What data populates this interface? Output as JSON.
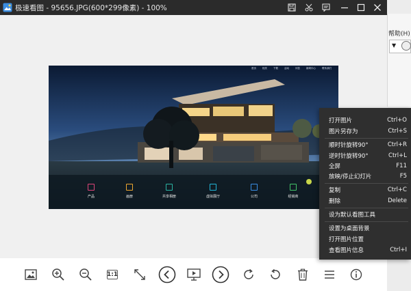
{
  "window": {
    "title": "极速看图 - 95656.JPG(600*299像素) - 100%",
    "icons": [
      "save-icon",
      "cut-icon",
      "comment-icon",
      "minimize-icon",
      "maximize-icon",
      "close-icon"
    ]
  },
  "background_app": {
    "help_label": "帮助(H)"
  },
  "photo": {
    "nav": [
      "首页",
      "相关",
      "下载",
      "活动",
      "问答",
      "新闻中心",
      "联系我们"
    ],
    "categories": [
      {
        "label": "产品",
        "color": "#e0457b"
      },
      {
        "label": "画册",
        "color": "#f0a830"
      },
      {
        "label": "共享相册",
        "color": "#2bb5a5"
      },
      {
        "label": "虚拟展厅",
        "color": "#22b6d8"
      },
      {
        "label": "公司",
        "color": "#3a8ee6"
      },
      {
        "label": "经销商",
        "color": "#43c46a"
      }
    ]
  },
  "toolbar": {
    "actual_size_label": "1:1",
    "tools": [
      "image-icon",
      "zoom-in-icon",
      "zoom-out-icon",
      "actual-size-icon",
      "fullscreen-icon",
      "previous-icon",
      "slideshow-icon",
      "next-icon",
      "rotate-clockwise-icon",
      "rotate-counterclockwise-icon",
      "delete-icon",
      "menu-icon",
      "info-icon"
    ]
  },
  "context_menu": {
    "items": [
      {
        "label": "打开图片",
        "shortcut": "Ctrl+O"
      },
      {
        "label": "图片另存为",
        "shortcut": "Ctrl+S"
      },
      {
        "label": "顺时针旋转90°",
        "shortcut": "Ctrl+R"
      },
      {
        "label": "逆时针旋转90°",
        "shortcut": "Ctrl+L"
      },
      {
        "label": "全屏",
        "shortcut": "F11"
      },
      {
        "label": "放映/停止幻灯片",
        "shortcut": "F5"
      },
      {
        "label": "复制",
        "shortcut": "Ctrl+C"
      },
      {
        "label": "删除",
        "shortcut": "Delete"
      },
      {
        "label": "设为默认看图工具",
        "shortcut": ""
      },
      {
        "label": "设置为桌面背景",
        "shortcut": ""
      },
      {
        "label": "打开图片位置",
        "shortcut": ""
      },
      {
        "label": "查看图片信息",
        "shortcut": "Ctrl+I"
      }
    ]
  }
}
